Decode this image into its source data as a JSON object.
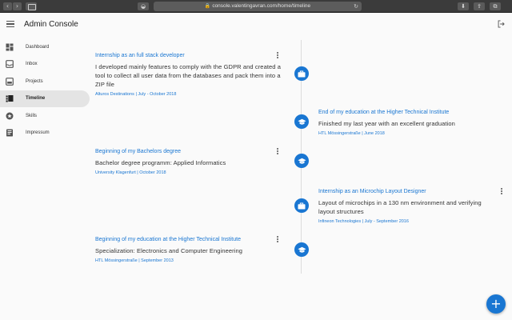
{
  "browser": {
    "url": "console.valentingavran.com/home/timeline"
  },
  "app": {
    "title": "Admin Console"
  },
  "sidebar": {
    "items": [
      {
        "label": "Dashboard",
        "icon": "dashboard-icon"
      },
      {
        "label": "Inbox",
        "icon": "inbox-icon"
      },
      {
        "label": "Projects",
        "icon": "projects-icon"
      },
      {
        "label": "Timeline",
        "icon": "timeline-icon",
        "active": true
      },
      {
        "label": "Skills",
        "icon": "star-icon"
      },
      {
        "label": "Impressum",
        "icon": "book-icon"
      }
    ]
  },
  "timeline": {
    "entries": [
      {
        "title": "Internship as an full stack developer",
        "description": "I developed mainly features to comply with the GDPR and created a tool to collect all user data from the databases and pack them into a ZIP file",
        "meta": "Alturos Destinations | July - October 2018",
        "icon": "briefcase-icon",
        "side": "left"
      },
      {
        "title": "End of my education at the Higher Technical Institute",
        "description": "Finished my last year with an excellent graduation",
        "meta": "HTL Mössingerstraße | June 2018",
        "icon": "graduation-cap-icon",
        "side": "right"
      },
      {
        "title": "Beginning of my Bachelors degree",
        "description": "Bachelor degree programm: Applied Informatics",
        "meta": "University Klagenfurt | October 2018",
        "icon": "graduation-cap-icon",
        "side": "left"
      },
      {
        "title": "Internship as an Microchip Layout Designer",
        "description": "Layout of microchips in a 130 nm environment and verifying layout structures",
        "meta": "Infineon Technologies | July - September 2016",
        "icon": "briefcase-icon",
        "side": "right"
      },
      {
        "title": "Beginning of my education at the Higher Technical Institute",
        "description": "Specialization: Electronics and Computer Engineering",
        "meta": "HTL Mössingerstraße | September 2013",
        "icon": "graduation-cap-icon",
        "side": "left"
      }
    ]
  },
  "fab": {
    "label": "+"
  },
  "colors": {
    "accent": "#1976d2",
    "background": "#fafafa",
    "active_nav": "#e4e4e4"
  }
}
